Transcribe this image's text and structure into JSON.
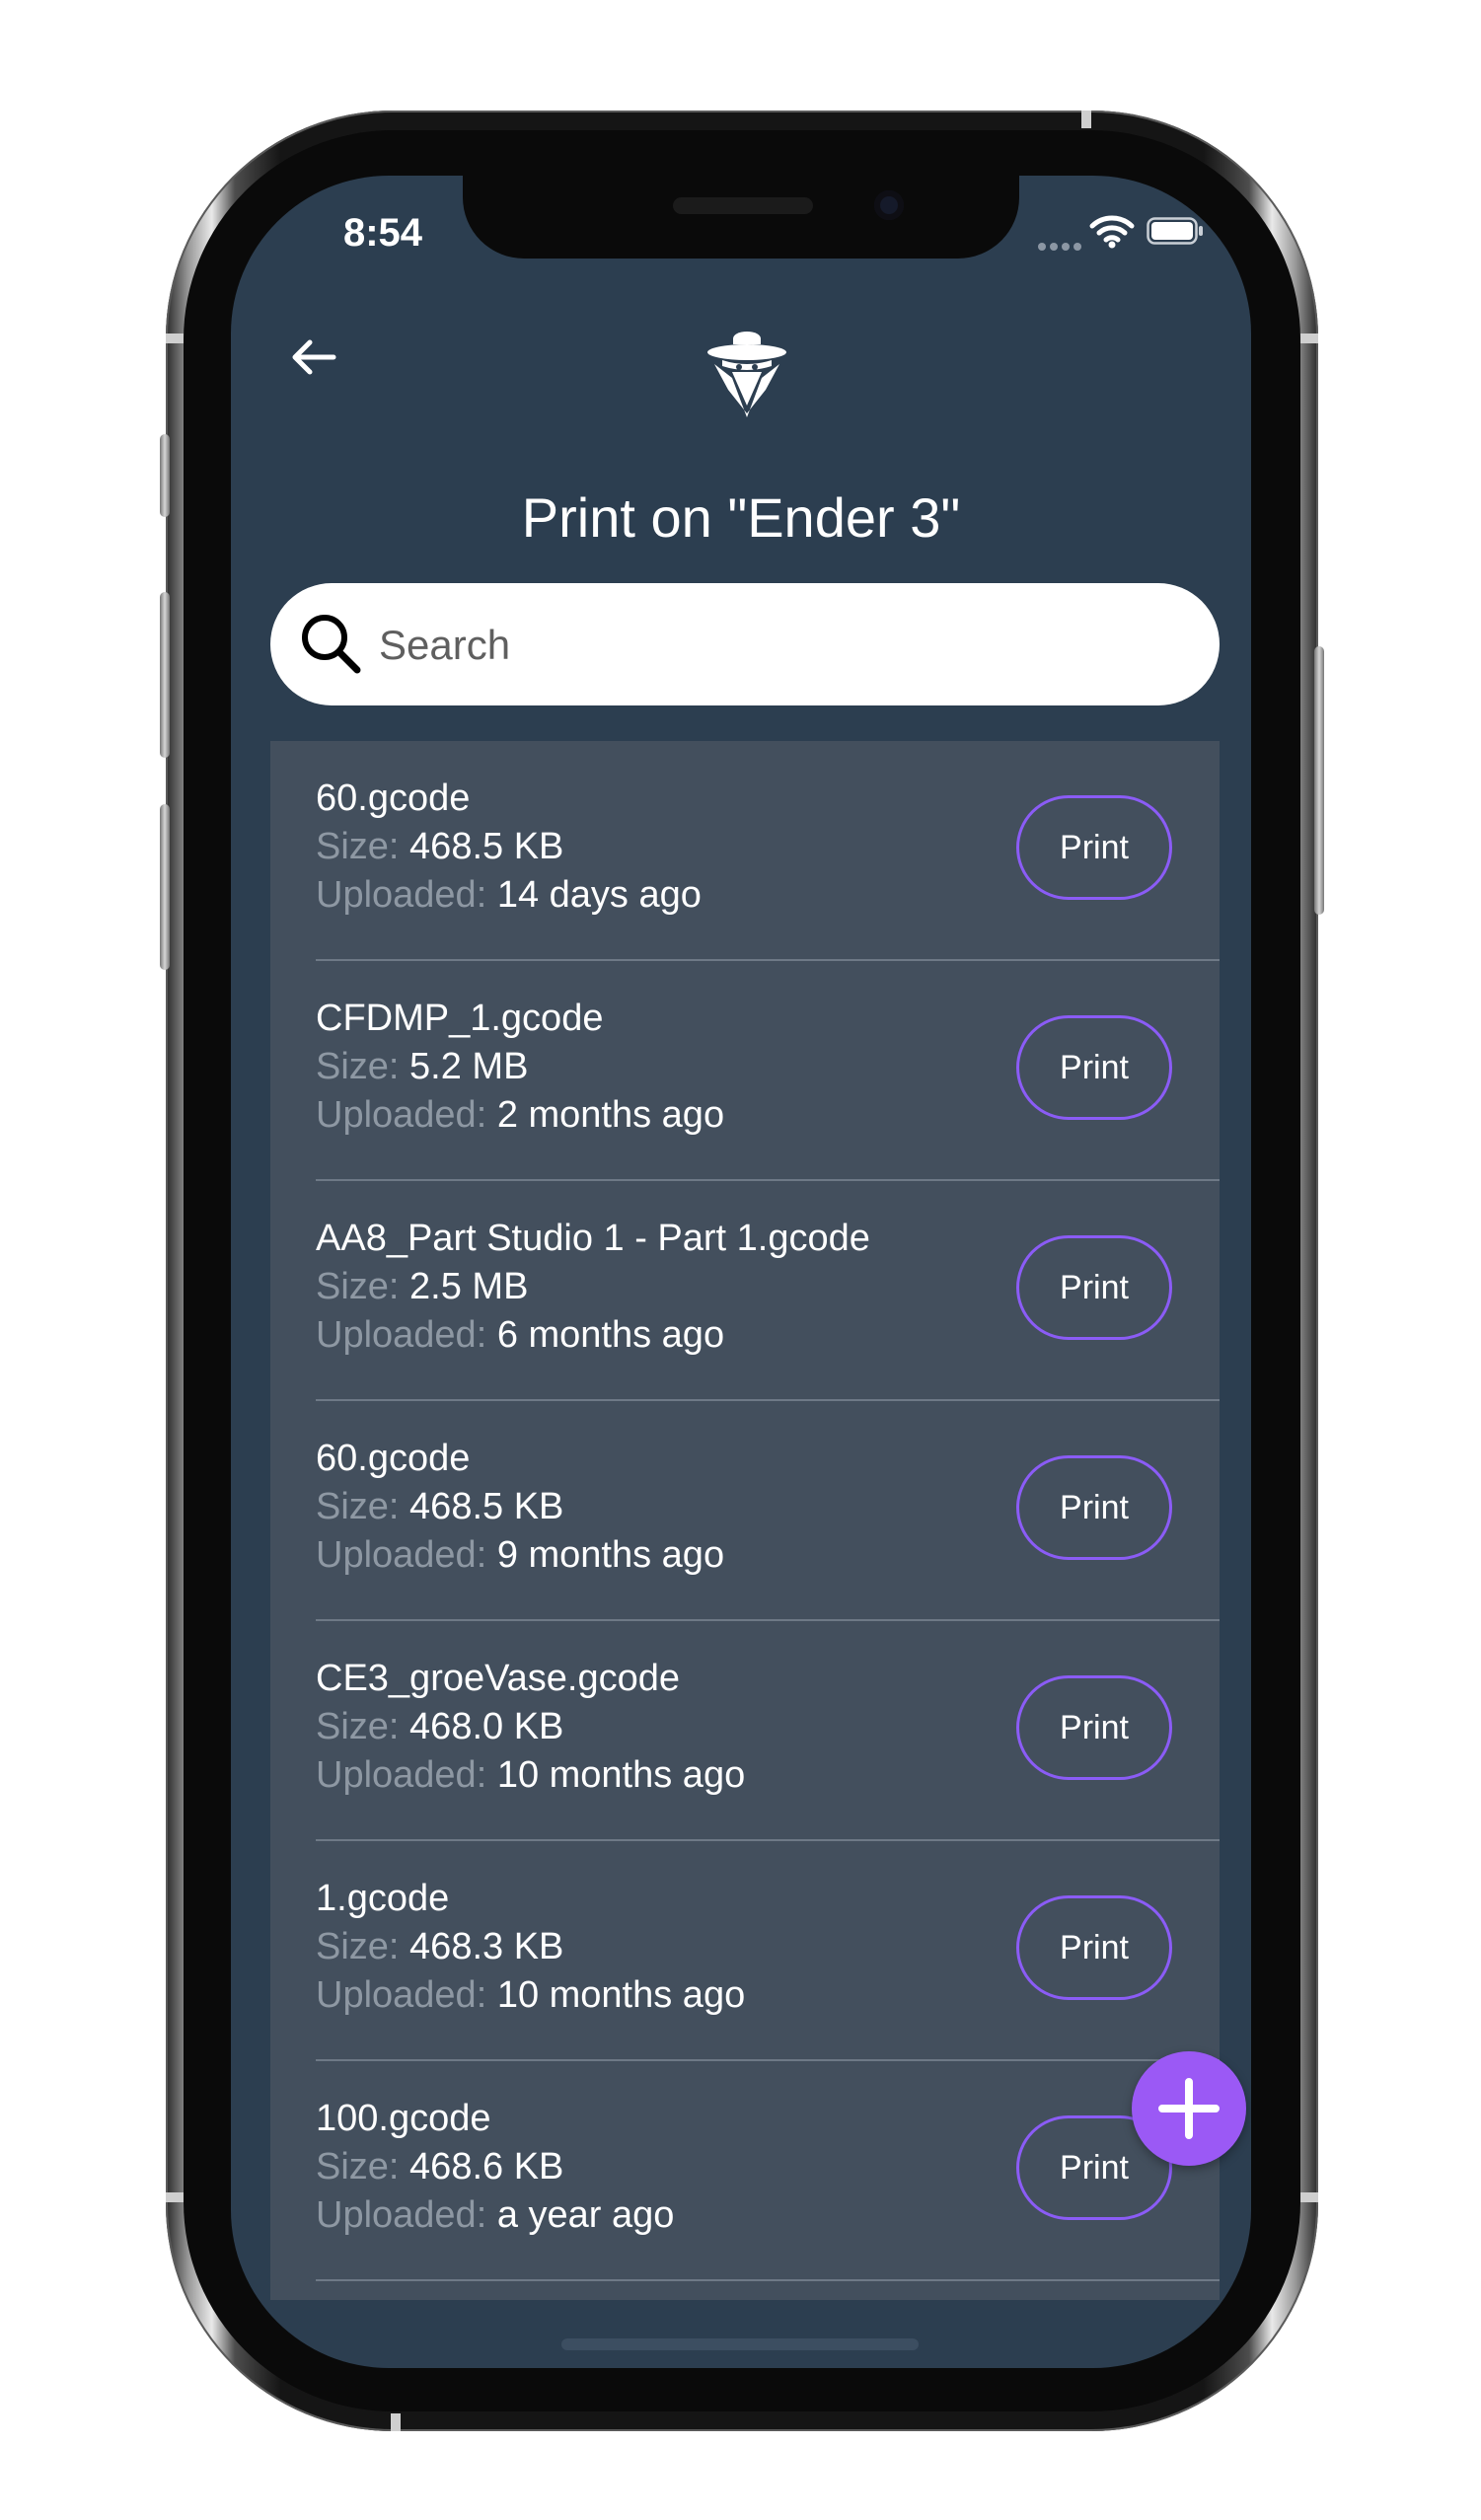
{
  "status_bar": {
    "time": "8:54"
  },
  "header": {
    "back_icon": "arrow-left-icon",
    "logo_icon": "spy-hat-logo-icon",
    "title": "Print on \"Ender 3\""
  },
  "search": {
    "placeholder": "Search",
    "value": "",
    "icon": "search-icon"
  },
  "labels": {
    "size": "Size:",
    "uploaded": "Uploaded:",
    "print": "Print"
  },
  "files": [
    {
      "name": "60.gcode",
      "size": "468.5 KB",
      "uploaded": "14 days ago"
    },
    {
      "name": "CFDMP_1.gcode",
      "size": "5.2 MB",
      "uploaded": "2 months ago"
    },
    {
      "name": "AA8_Part Studio 1 - Part 1.gcode",
      "size": "2.5 MB",
      "uploaded": "6 months ago"
    },
    {
      "name": "60.gcode",
      "size": "468.5 KB",
      "uploaded": "9 months ago"
    },
    {
      "name": "CE3_groeVase.gcode",
      "size": "468.0 KB",
      "uploaded": "10 months ago"
    },
    {
      "name": "1.gcode",
      "size": "468.3 KB",
      "uploaded": "10 months ago"
    },
    {
      "name": "100.gcode",
      "size": "468.6 KB",
      "uploaded": "a year ago"
    }
  ],
  "fab": {
    "icon": "plus-icon"
  },
  "colors": {
    "background": "#2c3e50",
    "list_background": "#434f5d",
    "accent": "#8b5cf6",
    "fab": "#9b59f5"
  }
}
